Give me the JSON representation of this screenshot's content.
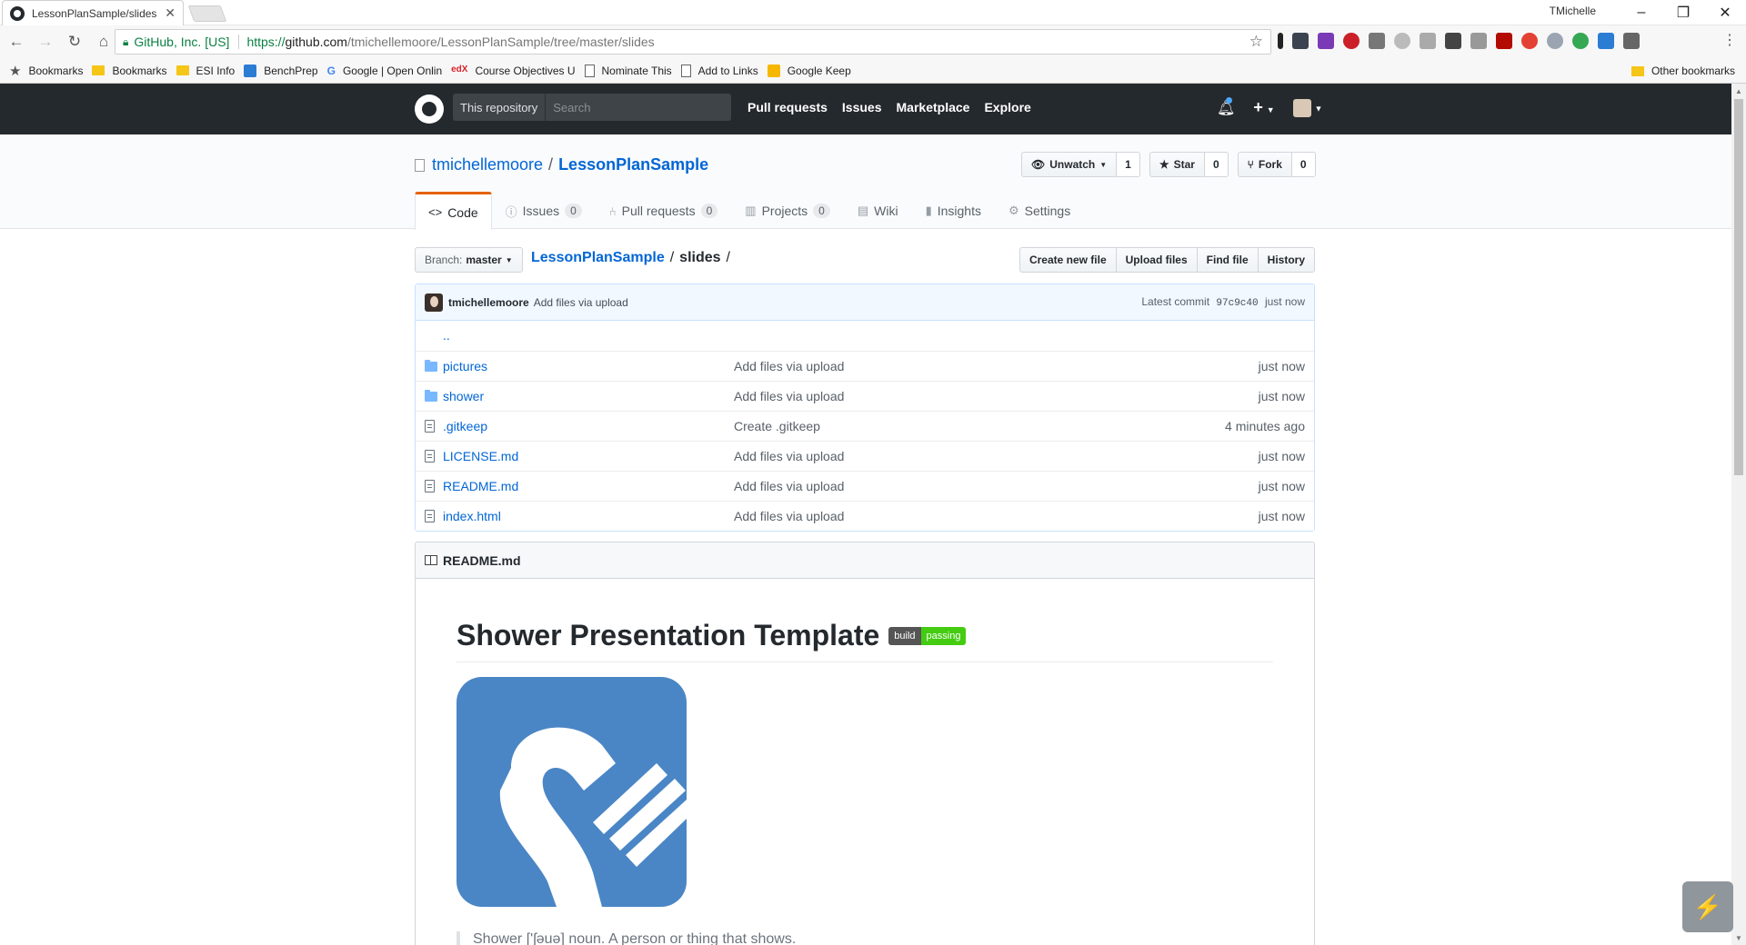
{
  "browser": {
    "tab_title": "LessonPlanSample/slides",
    "window_user": "TMichelle",
    "omnibox": {
      "cert": "GitHub, Inc. [US]",
      "url_scheme": "https://",
      "url_host": "github.com",
      "url_path": "/tmichellemoore/LessonPlanSample/tree/master/slides"
    },
    "bookmarks": {
      "bar_label": "Bookmarks",
      "items": [
        {
          "label": "Bookmarks",
          "icon": "folder-icon"
        },
        {
          "label": "ESI Info",
          "icon": "folder-icon"
        },
        {
          "label": "BenchPrep",
          "icon": "benchprep-icon",
          "color": "#2b7cd3"
        },
        {
          "label": "Google | Open Onlin",
          "icon": "google-icon",
          "color": "#4285f4"
        },
        {
          "label": "Course Objectives U",
          "icon": "edx-icon",
          "color": "#d8232a"
        },
        {
          "label": "Nominate This",
          "icon": "page-icon"
        },
        {
          "label": "Add to Links",
          "icon": "page-icon"
        },
        {
          "label": "Google Keep",
          "icon": "keep-icon",
          "color": "#f6b700"
        }
      ],
      "other": "Other bookmarks"
    },
    "extensions": [
      "instapaper-icon",
      "lastpass-icon",
      "onenote-icon",
      "pinterest-icon",
      "ext-gray-icon",
      "ext-circle-icon",
      "ext-cloud-icon",
      "evernote-icon",
      "ext-g-icon",
      "acrobat-icon",
      "chrome-ext-icon",
      "skype-icon",
      "color-icon",
      "ext-blue-icon",
      "cast-icon"
    ]
  },
  "github": {
    "search_scope": "This repository",
    "search_placeholder": "Search",
    "nav": [
      "Pull requests",
      "Issues",
      "Marketplace",
      "Explore"
    ],
    "brand_color": "#24292e"
  },
  "repo": {
    "owner": "tmichellemoore",
    "separator": "/",
    "name": "LessonPlanSample",
    "watch_label": "Unwatch",
    "watch_count": "1",
    "star_label": "Star",
    "star_count": "0",
    "fork_label": "Fork",
    "fork_count": "0",
    "tabs": {
      "code": "Code",
      "issues": "Issues",
      "issues_count": "0",
      "pulls": "Pull requests",
      "pulls_count": "0",
      "projects": "Projects",
      "projects_count": "0",
      "wiki": "Wiki",
      "insights": "Insights",
      "settings": "Settings"
    }
  },
  "file_nav": {
    "branch_label": "Branch:",
    "branch": "master",
    "crumb_root": "LessonPlanSample",
    "crumb_sep": "/",
    "crumb_final": "slides",
    "trailing_sep": "/",
    "actions": [
      "Create new file",
      "Upload files",
      "Find file",
      "History"
    ]
  },
  "commit": {
    "author": "tmichellemoore",
    "message": "Add files via upload",
    "latest_label": "Latest commit",
    "sha": "97c9c40",
    "age": "just now"
  },
  "files": [
    {
      "type": "up",
      "name": "..",
      "message": "",
      "age": ""
    },
    {
      "type": "dir",
      "name": "pictures",
      "message": "Add files via upload",
      "age": "just now"
    },
    {
      "type": "dir",
      "name": "shower",
      "message": "Add files via upload",
      "age": "just now"
    },
    {
      "type": "file",
      "name": ".gitkeep",
      "message": "Create .gitkeep",
      "age": "4 minutes ago"
    },
    {
      "type": "file",
      "name": "LICENSE.md",
      "message": "Add files via upload",
      "age": "just now"
    },
    {
      "type": "file",
      "name": "README.md",
      "message": "Add files via upload",
      "age": "just now"
    },
    {
      "type": "file",
      "name": "index.html",
      "message": "Add files via upload",
      "age": "just now"
    }
  ],
  "readme": {
    "filename": "README.md",
    "title": "Shower Presentation Template",
    "badge_left": "build",
    "badge_right": "passing",
    "badge_color": "#44cc11",
    "logo_color": "#4a86c5",
    "quote": "Shower ['ʃəuə] noun. A person or thing that shows."
  }
}
